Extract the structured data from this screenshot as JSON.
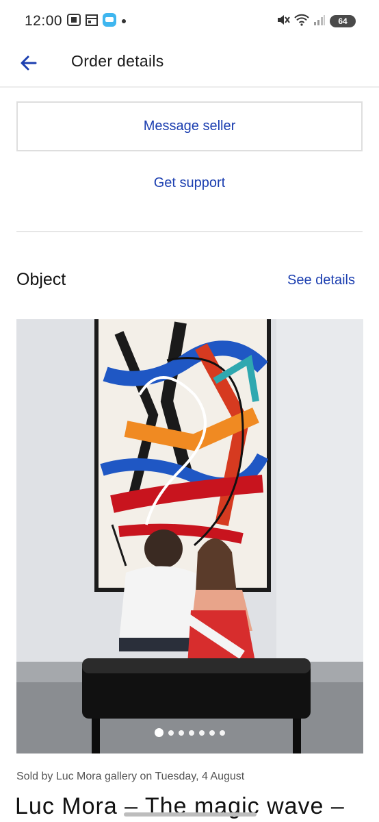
{
  "status_bar": {
    "time": "12:00",
    "battery": "64",
    "left_icons": [
      "screenshot-icon",
      "calendar-icon",
      "chat-app-icon",
      "notification-dot-icon"
    ],
    "right_icons": [
      "mute-vibrate-icon",
      "wifi-icon",
      "cell-signal-icon",
      "battery-icon"
    ]
  },
  "header": {
    "title": "Order details",
    "back_icon": "arrow-left-icon"
  },
  "actions": {
    "message_seller": "Message seller",
    "get_support": "Get support"
  },
  "object_section": {
    "title": "Object",
    "see_details": "See details",
    "image_alt": "Abstract painting with two people sitting on a bench",
    "carousel_count": 7,
    "carousel_active_index": 0,
    "sold_by": "Sold by Luc Mora gallery on Tuesday, 4 August",
    "artwork_title": "Luc Mora – The magic wave –"
  },
  "colors": {
    "accent": "#1c3fb0",
    "divider": "#e6e6e6",
    "text": "#1a1a1a"
  }
}
